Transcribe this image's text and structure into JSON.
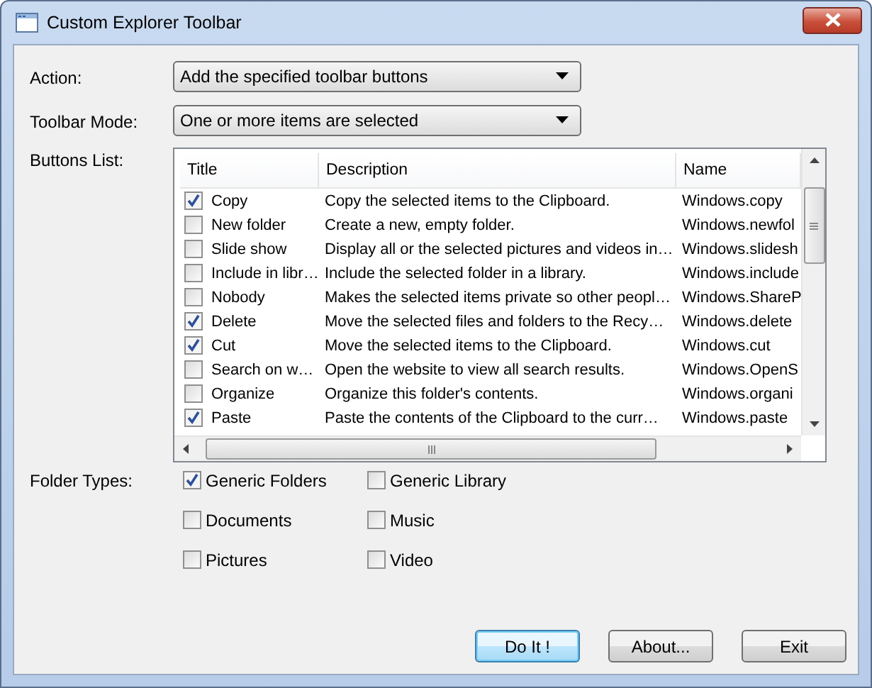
{
  "window": {
    "title": "Custom Explorer Toolbar"
  },
  "action": {
    "label": "Action:",
    "value": "Add the specified toolbar buttons"
  },
  "toolbar_mode": {
    "label": "Toolbar Mode:",
    "value": "One or more items are selected"
  },
  "buttons_list": {
    "label": "Buttons List:",
    "columns": [
      "Title",
      "Description",
      "Name"
    ],
    "rows": [
      {
        "title": "Copy",
        "description": "Copy the selected items to the Clipboard.",
        "name": "Windows.copy",
        "checked": true
      },
      {
        "title": "New folder",
        "description": "Create a new, empty folder.",
        "name": "Windows.newfol",
        "checked": false
      },
      {
        "title": "Slide show",
        "description": "Display all or the selected pictures and videos in…",
        "name": "Windows.slidesh",
        "checked": false
      },
      {
        "title": "Include in libr…",
        "description": "Include the selected folder in a library.",
        "name": "Windows.include",
        "checked": false
      },
      {
        "title": "Nobody",
        "description": "Makes the selected items private so other peopl…",
        "name": "Windows.ShareP",
        "checked": false
      },
      {
        "title": "Delete",
        "description": "Move the selected files and folders to the Recy…",
        "name": "Windows.delete",
        "checked": true
      },
      {
        "title": "Cut",
        "description": "Move the selected items to the Clipboard.",
        "name": "Windows.cut",
        "checked": true
      },
      {
        "title": "Search on w…",
        "description": "Open the website to view all search results.",
        "name": "Windows.OpenS",
        "checked": false
      },
      {
        "title": "Organize",
        "description": "Organize this folder's contents.",
        "name": "Windows.organi",
        "checked": false
      },
      {
        "title": "Paste",
        "description": "Paste the contents of the Clipboard to the curr…",
        "name": "Windows.paste",
        "checked": true
      }
    ]
  },
  "folder_types": {
    "label": "Folder Types:",
    "options": [
      {
        "label": "Generic Folders",
        "checked": true
      },
      {
        "label": "Generic Library",
        "checked": false
      },
      {
        "label": "Documents",
        "checked": false
      },
      {
        "label": "Music",
        "checked": false
      },
      {
        "label": "Pictures",
        "checked": false
      },
      {
        "label": "Video",
        "checked": false
      }
    ]
  },
  "buttons": [
    {
      "label": "Do It !",
      "default": true
    },
    {
      "label": "About...",
      "default": false
    },
    {
      "label": "Exit",
      "default": false
    }
  ]
}
